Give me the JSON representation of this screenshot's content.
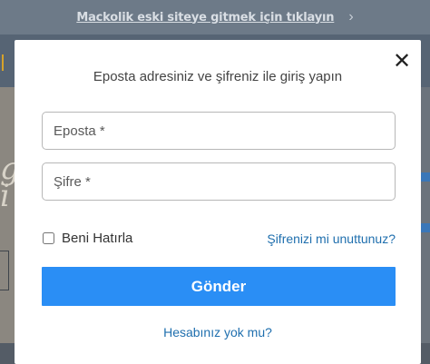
{
  "banner": {
    "link_text": "Mackolik eski siteye gitmek için tıklayın",
    "chevron": "›"
  },
  "background": {
    "glyph": "g\ni"
  },
  "modal": {
    "close_symbol": "✕",
    "title": "Eposta adresiniz ve şifreniz ile giriş yapın",
    "email_placeholder": "Eposta *",
    "email_value": "",
    "password_placeholder": "Şifre *",
    "password_value": "",
    "remember_label": "Beni Hatırla",
    "remember_checked": false,
    "forgot_link": "Şifrenizi mi unuttunuz?",
    "submit_label": "Gönder",
    "signup_link": "Hesabınız yok mu?"
  },
  "colors": {
    "primary": "#2a8ef5",
    "link": "#1f6fae",
    "overlay": "#6d7a88"
  }
}
